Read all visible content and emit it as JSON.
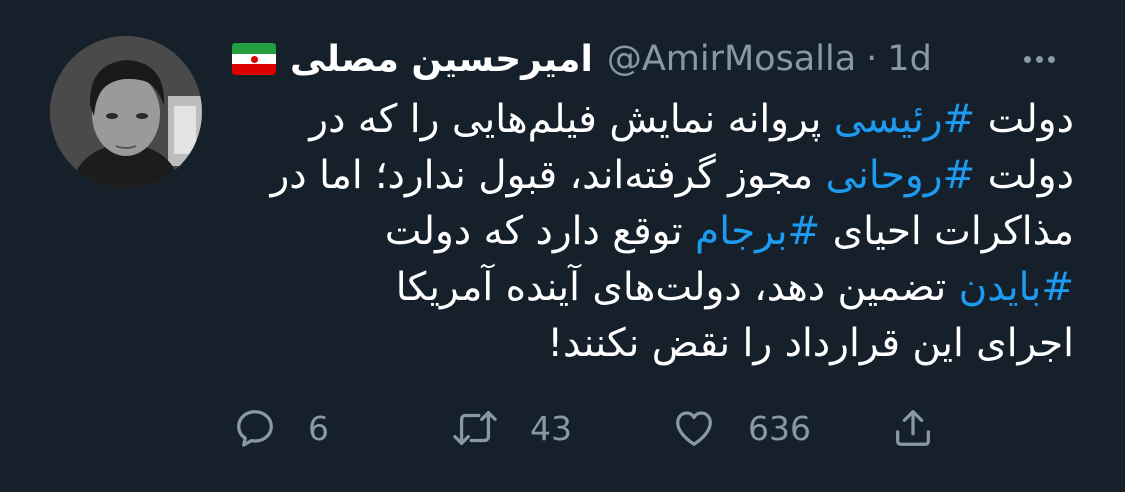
{
  "tweet": {
    "author_name": "امیرحسین مصلی",
    "handle": "@AmirMosalla",
    "separator": "·",
    "time": "1d",
    "lines": [
      [
        {
          "t": "دولت "
        },
        {
          "t": "#رئیسی",
          "tag": true
        },
        {
          "t": " پروانه نمایش فیلم‌هایی را که در"
        }
      ],
      [
        {
          "t": "دولت "
        },
        {
          "t": "#روحانی",
          "tag": true
        },
        {
          "t": " مجوز گرفته‌اند، قبول ندارد؛ اما در"
        }
      ],
      [
        {
          "t": "مذاکرات احیای "
        },
        {
          "t": "#برجام",
          "tag": true
        },
        {
          "t": " توقع دارد که دولت"
        }
      ],
      [
        {
          "t": "#بایدن",
          "tag": true
        },
        {
          "t": " تضمین دهد، دولت‌های آینده آمریکا"
        }
      ],
      [
        {
          "t": "اجرای این قرارداد را نقض نکنند!"
        }
      ]
    ]
  },
  "actions": {
    "replies": "6",
    "retweets": "43",
    "likes": "636"
  },
  "icons": {
    "reply": "reply-icon",
    "retweet": "retweet-icon",
    "like": "heart-icon",
    "share": "share-icon",
    "more": "more-icon",
    "flag": "iran-flag-icon"
  },
  "colors": {
    "background": "#15202b",
    "text": "#ffffff",
    "muted": "#8899a6",
    "hashtag": "#1d9bf0"
  }
}
